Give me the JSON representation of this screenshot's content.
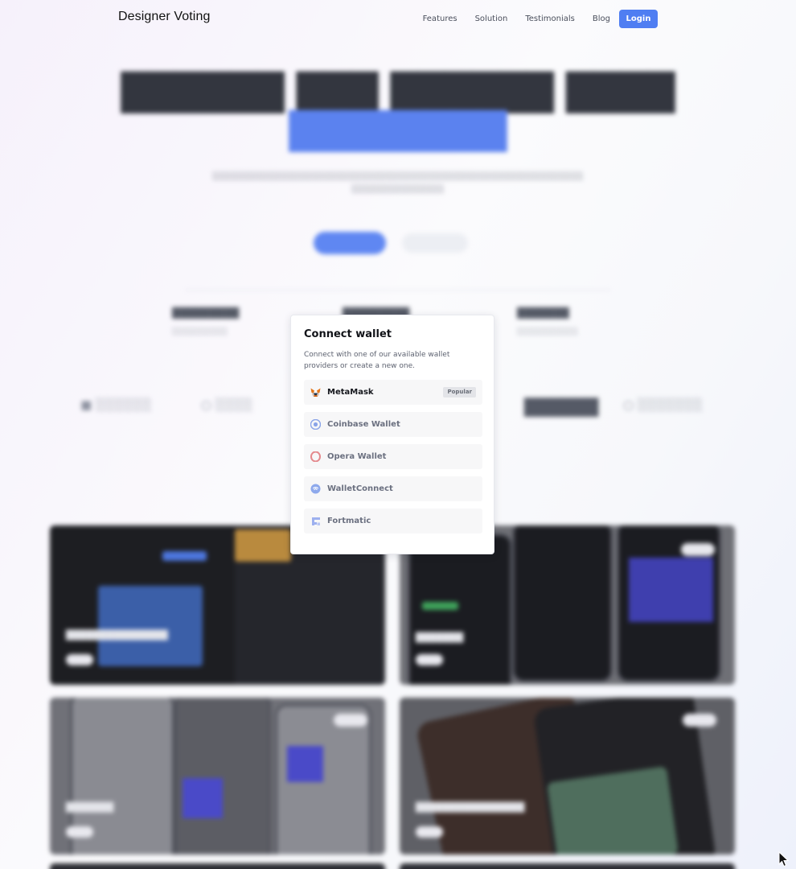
{
  "nav": {
    "brand": "Designer Voting",
    "links": [
      "Features",
      "Solution",
      "Testimonials",
      "Blog"
    ],
    "login_label": "Login",
    "accent_color": "#4f7ef2"
  },
  "modal": {
    "title": "Connect wallet",
    "description": "Connect with one of our available wallet providers or create a new one.",
    "wallets": [
      {
        "label": "MetaMask",
        "icon": "metamask-fox-icon",
        "badge": "Popular"
      },
      {
        "label": "Coinbase Wallet",
        "icon": "coinbase-icon"
      },
      {
        "label": "Opera Wallet",
        "icon": "opera-icon"
      },
      {
        "label": "WalletConnect",
        "icon": "walletconnect-icon"
      },
      {
        "label": "Fortmatic",
        "icon": "fortmatic-icon"
      }
    ]
  }
}
